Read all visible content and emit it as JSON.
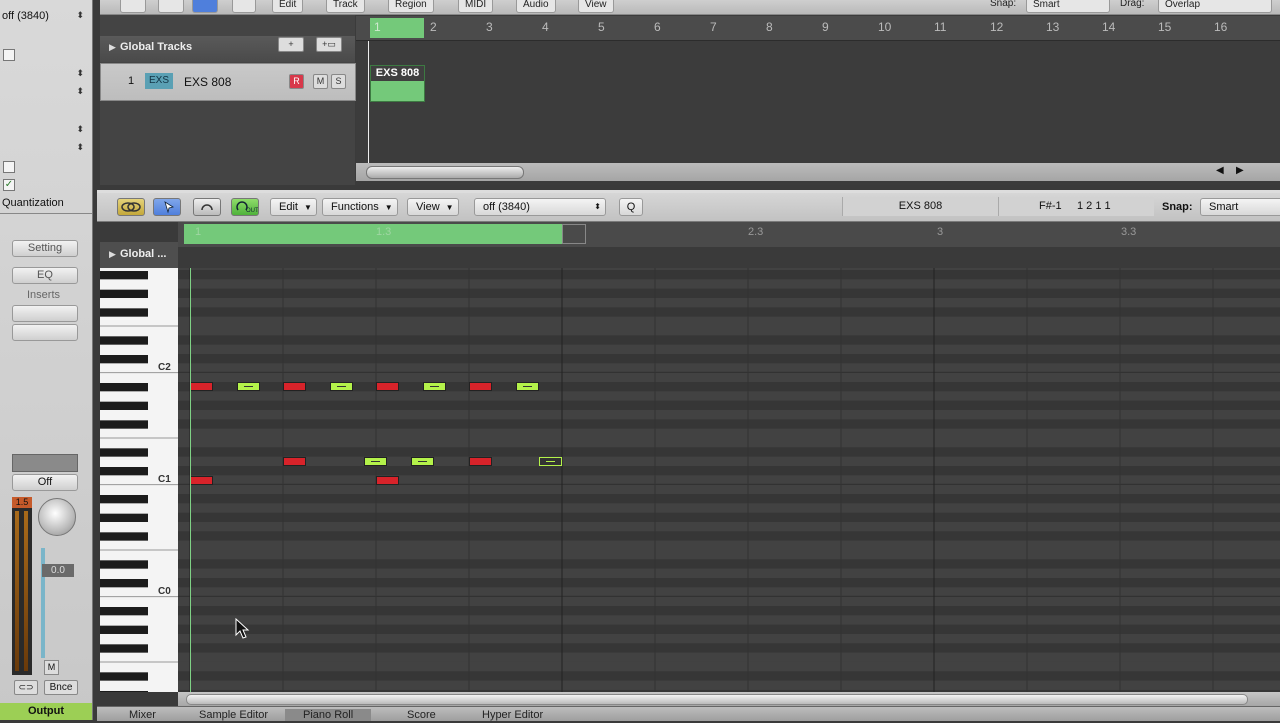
{
  "inspector": {
    "quantize_value": "off (3840)",
    "quantization_label": "Quantization",
    "setting_button": "Setting",
    "eq_button": "EQ",
    "inserts_label": "Inserts",
    "off_button": "Off",
    "volume_value": "0.0",
    "peak_value": "1.5",
    "mute_label": "M",
    "bounce_button": "Bnce",
    "output_label": "Output"
  },
  "arrange": {
    "menus": [
      "Edit",
      "Track",
      "Region",
      "MIDI",
      "Audio",
      "View"
    ],
    "snap_label": "Snap:",
    "snap_value": "Smart",
    "drag_label": "Drag:",
    "drag_value": "Overlap",
    "global_tracks_label": "Global Tracks",
    "track_number": "1",
    "track_type_badge": "EXS",
    "track_name": "EXS 808",
    "record_label": "R",
    "mute_label": "M",
    "solo_label": "S",
    "region_name": "EXS 808",
    "bar_numbers": [
      "1",
      "2",
      "3",
      "4",
      "5",
      "6",
      "7",
      "8",
      "9",
      "10",
      "11",
      "12",
      "13",
      "14",
      "15",
      "16"
    ]
  },
  "piano_roll": {
    "edit_menu": "Edit",
    "functions_menu": "Functions",
    "view_menu": "View",
    "quantize_value": "off (3840)",
    "q_button": "Q",
    "region_name": "EXS 808",
    "position_note": "F#-1",
    "position_value": "1 2 1 1",
    "snap_label": "Snap:",
    "snap_value": "Smart",
    "global_label": "Global ...",
    "ruler_labels": [
      "1",
      "1.3",
      "2.3",
      "3",
      "3.3"
    ],
    "octave_labels": [
      "C2",
      "C1",
      "C0"
    ],
    "notes": [
      {
        "color": "red",
        "beat": 0.0,
        "pitch": "A#1"
      },
      {
        "color": "green",
        "beat": 0.5,
        "pitch": "A#1"
      },
      {
        "color": "red",
        "beat": 1.0,
        "pitch": "A#1"
      },
      {
        "color": "green",
        "beat": 1.5,
        "pitch": "A#1"
      },
      {
        "color": "red",
        "beat": 2.0,
        "pitch": "A#1"
      },
      {
        "color": "green",
        "beat": 2.5,
        "pitch": "A#1"
      },
      {
        "color": "red",
        "beat": 3.0,
        "pitch": "A#1"
      },
      {
        "color": "green",
        "beat": 3.5,
        "pitch": "A#1"
      },
      {
        "color": "red",
        "beat": 1.0,
        "pitch": "D1"
      },
      {
        "color": "green",
        "beat": 1.875,
        "pitch": "D1"
      },
      {
        "color": "green",
        "beat": 2.375,
        "pitch": "D1"
      },
      {
        "color": "red",
        "beat": 3.0,
        "pitch": "D1"
      },
      {
        "color": "selected",
        "beat": 3.75,
        "pitch": "D1"
      },
      {
        "color": "red",
        "beat": 0.0,
        "pitch": "C1"
      },
      {
        "color": "red",
        "beat": 2.0,
        "pitch": "C1"
      }
    ]
  },
  "bottom_tabs": [
    "Mixer",
    "Sample Editor",
    "Piano Roll",
    "Score",
    "Hyper Editor"
  ],
  "colors": {
    "note_red": "#d8232a",
    "note_green": "#b4f24a",
    "region_green": "#74c97a",
    "tool_blue": "#4f7fdc",
    "output_green": "#9ccf55"
  }
}
